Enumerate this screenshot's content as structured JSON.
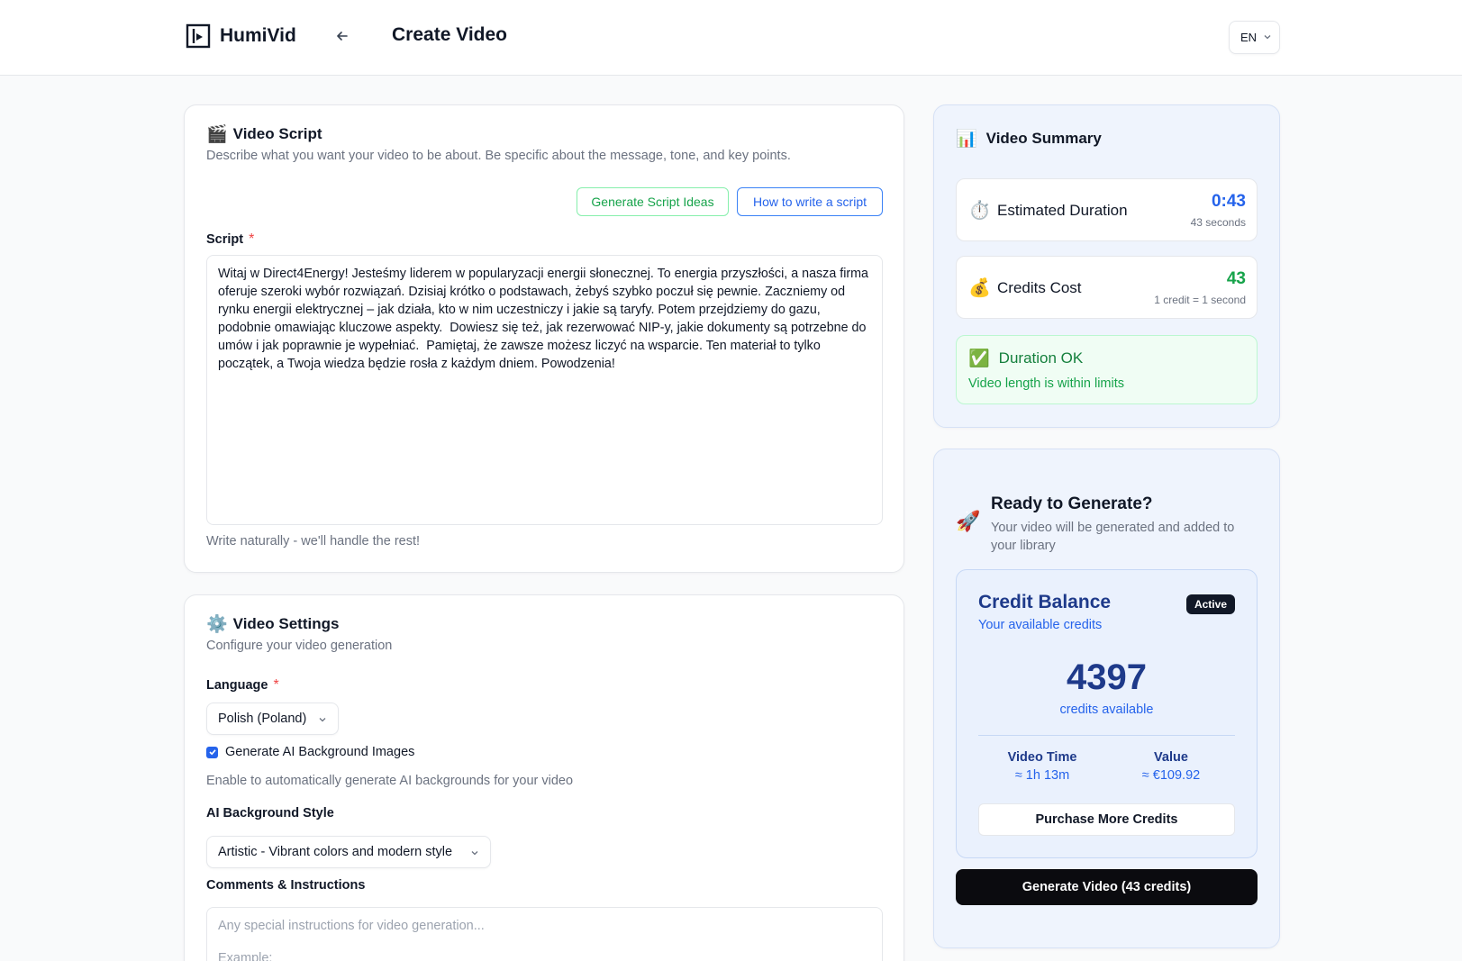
{
  "app": {
    "name": "HumiVid",
    "page_title": "Create Video",
    "language_selector": "EN"
  },
  "script_card": {
    "icon": "clapper-board-emoji",
    "title": "Video Script",
    "description": "Describe what you want your video to be about. Be specific about the message, tone, and key points.",
    "generate_ideas_label": "Generate Script Ideas",
    "how_to_label": "How to write a script",
    "script_label": "Script",
    "required_mark": "*",
    "script_text": "Witaj w Direct4Energy! Jesteśmy liderem w popularyzacji energii słonecznej. To energia przyszłości, a nasza firma oferuje szeroki wybór rozwiązań. Dzisiaj krótko o podstawach, żebyś szybko poczuł się pewnie. Zaczniemy od rynku energii elektrycznej – jak działa, kto w nim uczestniczy i jakie są taryfy. Potem przejdziemy do gazu, podobnie omawiając kluczowe aspekty.  Dowiesz się też, jak rezerwować NIP-y, jakie dokumenty są potrzebne do umów i jak poprawnie je wypełniać.  Pamiętaj, że zawsze możesz liczyć na wsparcie. Ten materiał to tylko początek, a Twoja wiedza będzie rosła z każdym dniem. Powodzenia!",
    "helper_text": "Write naturally - we'll handle the rest!"
  },
  "settings_card": {
    "icon": "gear-emoji",
    "title": "Video Settings",
    "description": "Configure your video generation",
    "language_label": "Language",
    "required_mark": "*",
    "language_value": "Polish (Poland)",
    "ai_bg_checkbox_label": "Generate AI Background Images",
    "ai_bg_checked": true,
    "ai_bg_help": "Enable to automatically generate AI backgrounds for your video",
    "style_label": "AI Background Style",
    "style_value": "Artistic - Vibrant colors and modern style",
    "comments_label": "Comments & Instructions",
    "comments_placeholder": "Any special instructions for video generation...",
    "comments_placeholder_line2": "Example:"
  },
  "summary": {
    "icon": "bar-chart-emoji",
    "title": "Video Summary",
    "duration_label": "Estimated Duration",
    "duration_value": "0:43",
    "duration_sub": "43 seconds",
    "cost_label": "Credits Cost",
    "cost_value": "43",
    "cost_sub": "1 credit = 1 second",
    "status_title": "Duration OK",
    "status_text": "Video length is within limits"
  },
  "generate": {
    "icon": "rocket-emoji",
    "title": "Ready to Generate?",
    "description": "Your video will be generated and added to your library",
    "credit_title": "Credit Balance",
    "credit_subtitle": "Your available credits",
    "badge": "Active",
    "credits": "4397",
    "credits_caption": "credits available",
    "video_time_label": "Video Time",
    "video_time_value": "≈ 1h 13m",
    "value_label": "Value",
    "value_value": "≈ €109.92",
    "purchase_label": "Purchase More Credits",
    "generate_label": "Generate Video (43 credits)"
  },
  "colors": {
    "accent_blue": "#2563eb",
    "success_green": "#16a34a",
    "dark_blue": "#1e3a8a",
    "primary_button": "#0b0b0f"
  }
}
